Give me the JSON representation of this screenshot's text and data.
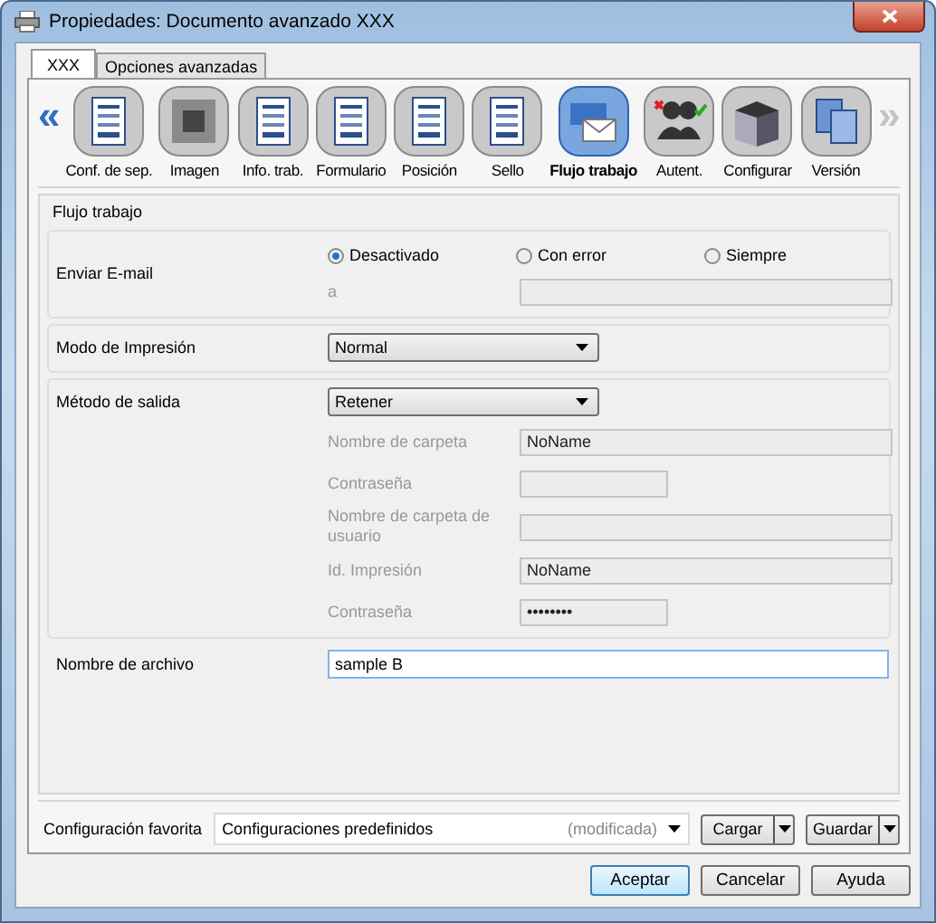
{
  "window": {
    "title": "Propiedades: Documento avanzado XXX"
  },
  "tabs": [
    {
      "label": "XXX",
      "selected": true
    },
    {
      "label": "Opciones avanzadas",
      "selected": false
    }
  ],
  "toolbar": {
    "scroll_left": {
      "label": "«",
      "disabled": false
    },
    "scroll_right": {
      "label": "»",
      "disabled": true
    },
    "items": [
      {
        "label": "Conf. de sep.",
        "selected": false
      },
      {
        "label": "Imagen",
        "selected": false
      },
      {
        "label": "Info. trab.",
        "selected": false
      },
      {
        "label": "Formulario",
        "selected": false
      },
      {
        "label": "Posición",
        "selected": false
      },
      {
        "label": "Sello",
        "selected": false
      },
      {
        "label": "Flujo trabajo",
        "selected": true
      },
      {
        "label": "Autent.",
        "selected": false
      },
      {
        "label": "Configurar",
        "selected": false
      },
      {
        "label": "Versión",
        "selected": false
      }
    ]
  },
  "section": {
    "title": "Flujo trabajo",
    "email": {
      "label": "Enviar E-mail",
      "options": [
        {
          "label": "Desactivado",
          "selected": true
        },
        {
          "label": "Con error",
          "selected": false
        },
        {
          "label": "Siempre",
          "selected": false
        }
      ],
      "to": {
        "label": "a",
        "disabled": true
      }
    },
    "print_mode": {
      "label": "Modo de Impresión",
      "value": "Normal"
    },
    "output": {
      "label": "Método de salida",
      "value": "Retener",
      "fields": [
        {
          "kind": "text",
          "label": "Nombre de carpeta",
          "value": "NoName",
          "disabled": true
        },
        {
          "kind": "password",
          "label": "Contraseña",
          "disabled": true
        },
        {
          "kind": "text",
          "label": "Nombre de carpeta de usuario",
          "disabled": true
        },
        {
          "kind": "text",
          "label": "Id. Impresión",
          "value": "NoName",
          "disabled": true
        },
        {
          "kind": "password",
          "label": "Contraseña",
          "value": "••••••••",
          "disabled": true
        }
      ]
    },
    "filename": {
      "label": "Nombre de archivo",
      "value": "sample B"
    }
  },
  "favorite": {
    "label": "Configuración favorita",
    "value": "Configuraciones predefinidos",
    "note": "(modificada)",
    "buttons": [
      "Cargar",
      "Guardar"
    ]
  },
  "buttons": [
    {
      "label": "Aceptar",
      "default": true
    },
    {
      "label": "Cancelar",
      "default": false
    },
    {
      "label": "Ayuda",
      "default": false
    }
  ]
}
